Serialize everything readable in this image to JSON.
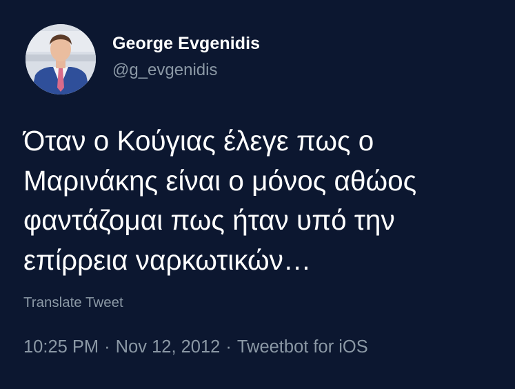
{
  "author": {
    "name": "George Evgenidis",
    "handle": "@g_evgenidis"
  },
  "tweet": {
    "lines": [
      "Όταν ο Κούγιας έλεγε πως ο",
      "Μαρινάκης είναι ο μόνος αθώος",
      "φαντάζομαι πως ήταν υπό την",
      "επίρρεια ναρκωτικών…"
    ],
    "translate_label": "Translate Tweet",
    "time": "10:25 PM",
    "separator": "·",
    "date": "Nov 12, 2012",
    "source": "Tweetbot for iOS"
  },
  "colors": {
    "background": "#0c1730",
    "primary_text": "#ffffff",
    "secondary_text": "#8b98a5"
  },
  "icons": {
    "avatar": "profile-photo-man-in-suit"
  }
}
